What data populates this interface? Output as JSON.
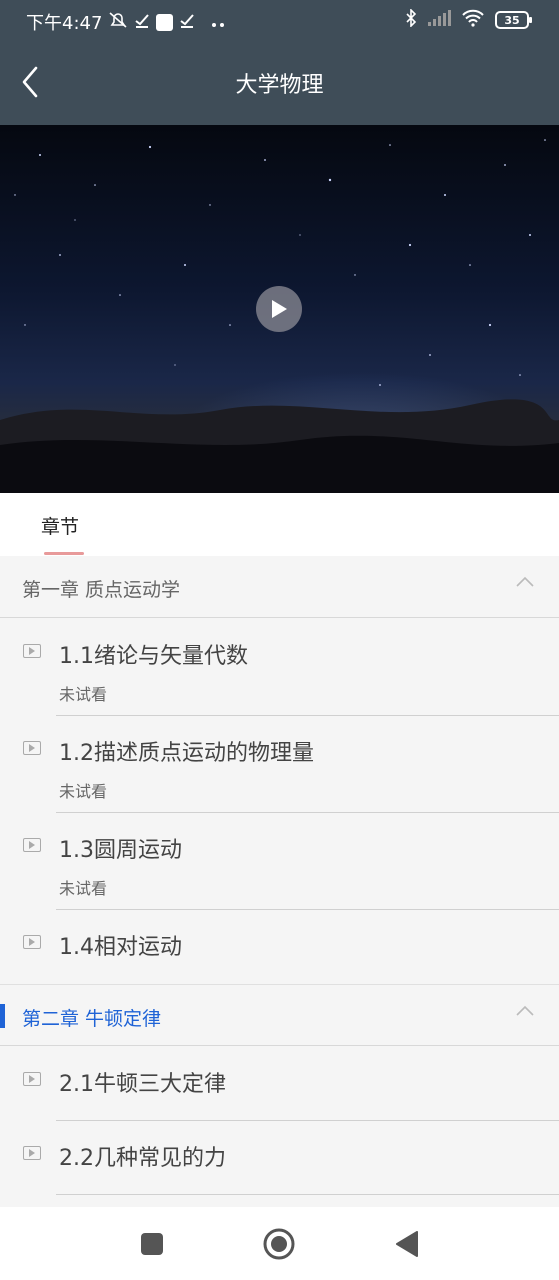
{
  "status_bar": {
    "time": "下午4:47",
    "battery": "35",
    "icons": [
      "alarm-off-icon",
      "check-icon",
      "square-icon",
      "check-icon",
      "more-dots-icon",
      "bluetooth-icon",
      "signal-icon",
      "wifi-icon",
      "battery-icon"
    ]
  },
  "header": {
    "title": "大学物理"
  },
  "tabs": [
    {
      "label": "章节",
      "active": true
    }
  ],
  "chapters": [
    {
      "title": "第一章 质点运动学",
      "expanded": true,
      "lessons": [
        {
          "title": "1.1绪论与矢量代数",
          "status": "未试看"
        },
        {
          "title": "1.2描述质点运动的物理量",
          "status": "未试看"
        },
        {
          "title": "1.3圆周运动",
          "status": "未试看"
        },
        {
          "title": "1.4相对运动",
          "status": ""
        }
      ]
    },
    {
      "title": "第二章 牛顿定律",
      "expanded": true,
      "active": true,
      "lessons": [
        {
          "title": "2.1牛顿三大定律",
          "status": ""
        },
        {
          "title": "2.2几种常见的力",
          "status": ""
        }
      ]
    }
  ],
  "colors": {
    "header_bg": "#3f4d58",
    "accent": "#1f63d6",
    "tab_indicator": "#e89a9a"
  }
}
